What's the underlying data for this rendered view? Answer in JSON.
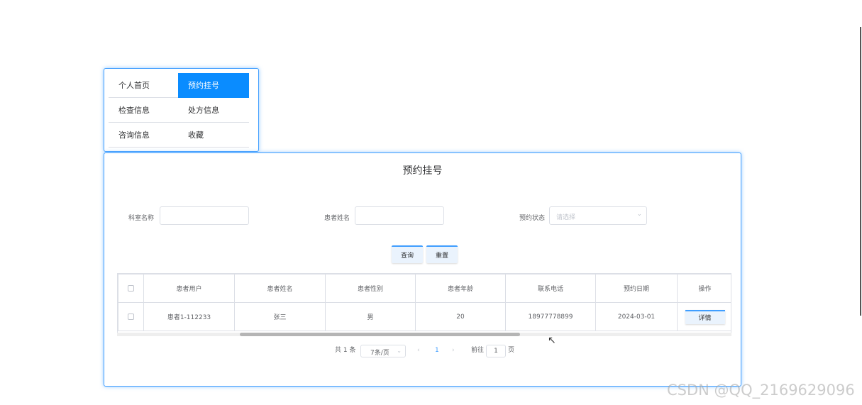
{
  "menu": {
    "items": [
      {
        "label": "个人首页"
      },
      {
        "label": "预约挂号"
      },
      {
        "label": "检查信息"
      },
      {
        "label": "处方信息"
      },
      {
        "label": "咨询信息"
      },
      {
        "label": "收藏"
      }
    ],
    "active_label": "预约挂号"
  },
  "page_title": "预约挂号",
  "search": {
    "dept_label": "科室名称",
    "dept_value": "",
    "name_label": "患者姓名",
    "name_value": "",
    "status_label": "预约状态",
    "status_placeholder": "请选择",
    "query_button": "查询",
    "reset_button": "重置"
  },
  "table": {
    "headers": [
      "患者用户",
      "患者姓名",
      "患者性别",
      "患者年龄",
      "联系电话",
      "预约日期",
      "操作"
    ],
    "rows": [
      {
        "user": "患者1-112233",
        "name": "张三",
        "gender": "男",
        "age": "20",
        "phone": "18977778899",
        "date": "2024-03-01",
        "action": "详情"
      }
    ]
  },
  "pagination": {
    "total_text": "共 1 条",
    "page_size": "7条/页",
    "current_page": "1",
    "goto_label": "前往",
    "goto_value": "1",
    "page_unit": "页"
  },
  "watermark": "CSDN @QQ_2169629096",
  "colors": {
    "accent": "#409eff",
    "active_menu": "#0a8cff"
  }
}
